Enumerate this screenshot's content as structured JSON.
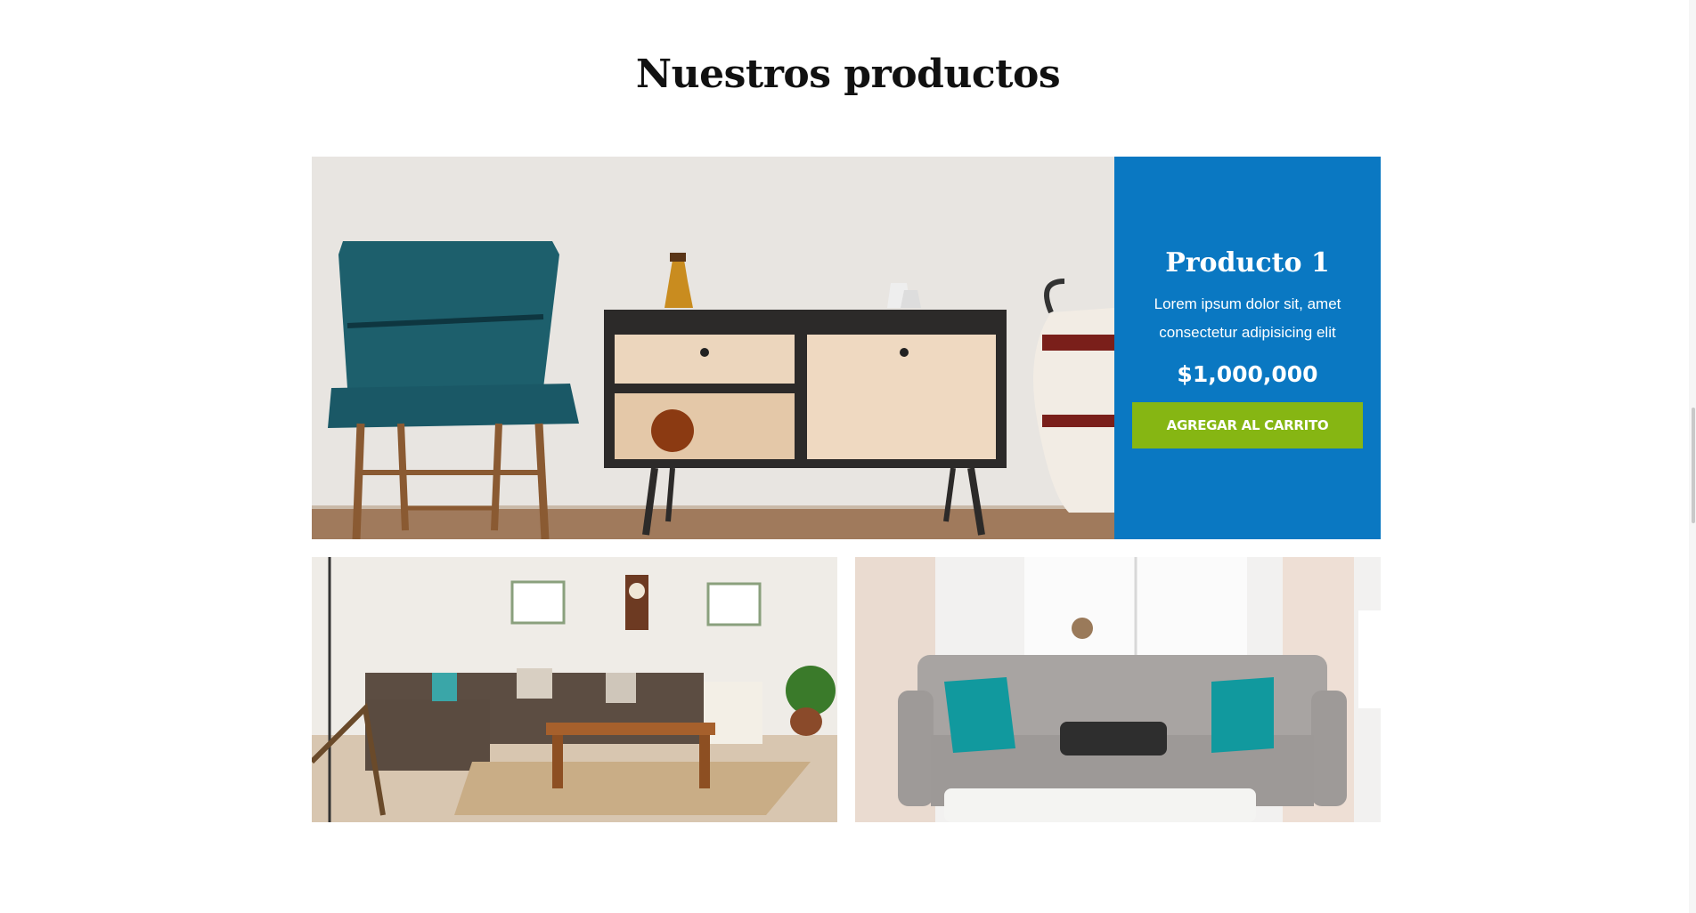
{
  "section": {
    "title": "Nuestros productos"
  },
  "featured_product": {
    "name": "Producto 1",
    "description": "Lorem ipsum dolor sit, amet consectetur adipisicing elit",
    "price": "$1,000,000",
    "button_label": "AGREGAR AL CARRITO",
    "image": "chair-and-sideboard-photo"
  },
  "gallery": {
    "left_image": "living-room-sectional-sofa-photo",
    "right_image": "grey-tufted-sofa-with-cat-photo"
  },
  "colors": {
    "panel_blue": "#0a78c2",
    "button_green": "#86b613",
    "title_text": "#111111"
  }
}
